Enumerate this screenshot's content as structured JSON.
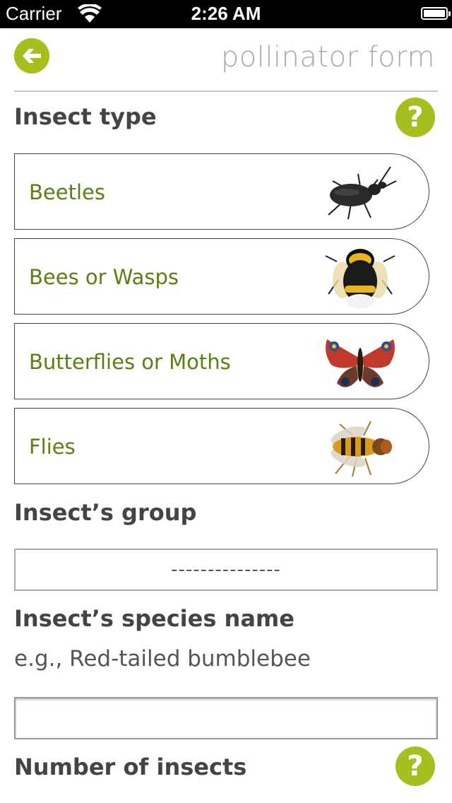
{
  "status_bar": {
    "carrier": "Carrier",
    "time": "2:26 AM"
  },
  "header": {
    "title": "pollinator form"
  },
  "sections": {
    "insect_type": "Insect type",
    "insect_group": "Insect’s group",
    "species_name": "Insect’s species name",
    "number_of_insects": "Number of insects"
  },
  "help_label": "?",
  "insect_options": [
    {
      "label": "Beetles",
      "icon": "beetle-icon"
    },
    {
      "label": "Bees or Wasps",
      "icon": "bee-icon"
    },
    {
      "label": "Butterflies or Moths",
      "icon": "butterfly-icon"
    },
    {
      "label": "Flies",
      "icon": "fly-icon"
    }
  ],
  "group_select": {
    "value": "---------------"
  },
  "species": {
    "hint": "e.g., Red-tailed bumblebee",
    "value": ""
  },
  "colors": {
    "accent": "#a6bf1f",
    "option_text": "#5a7f12"
  }
}
